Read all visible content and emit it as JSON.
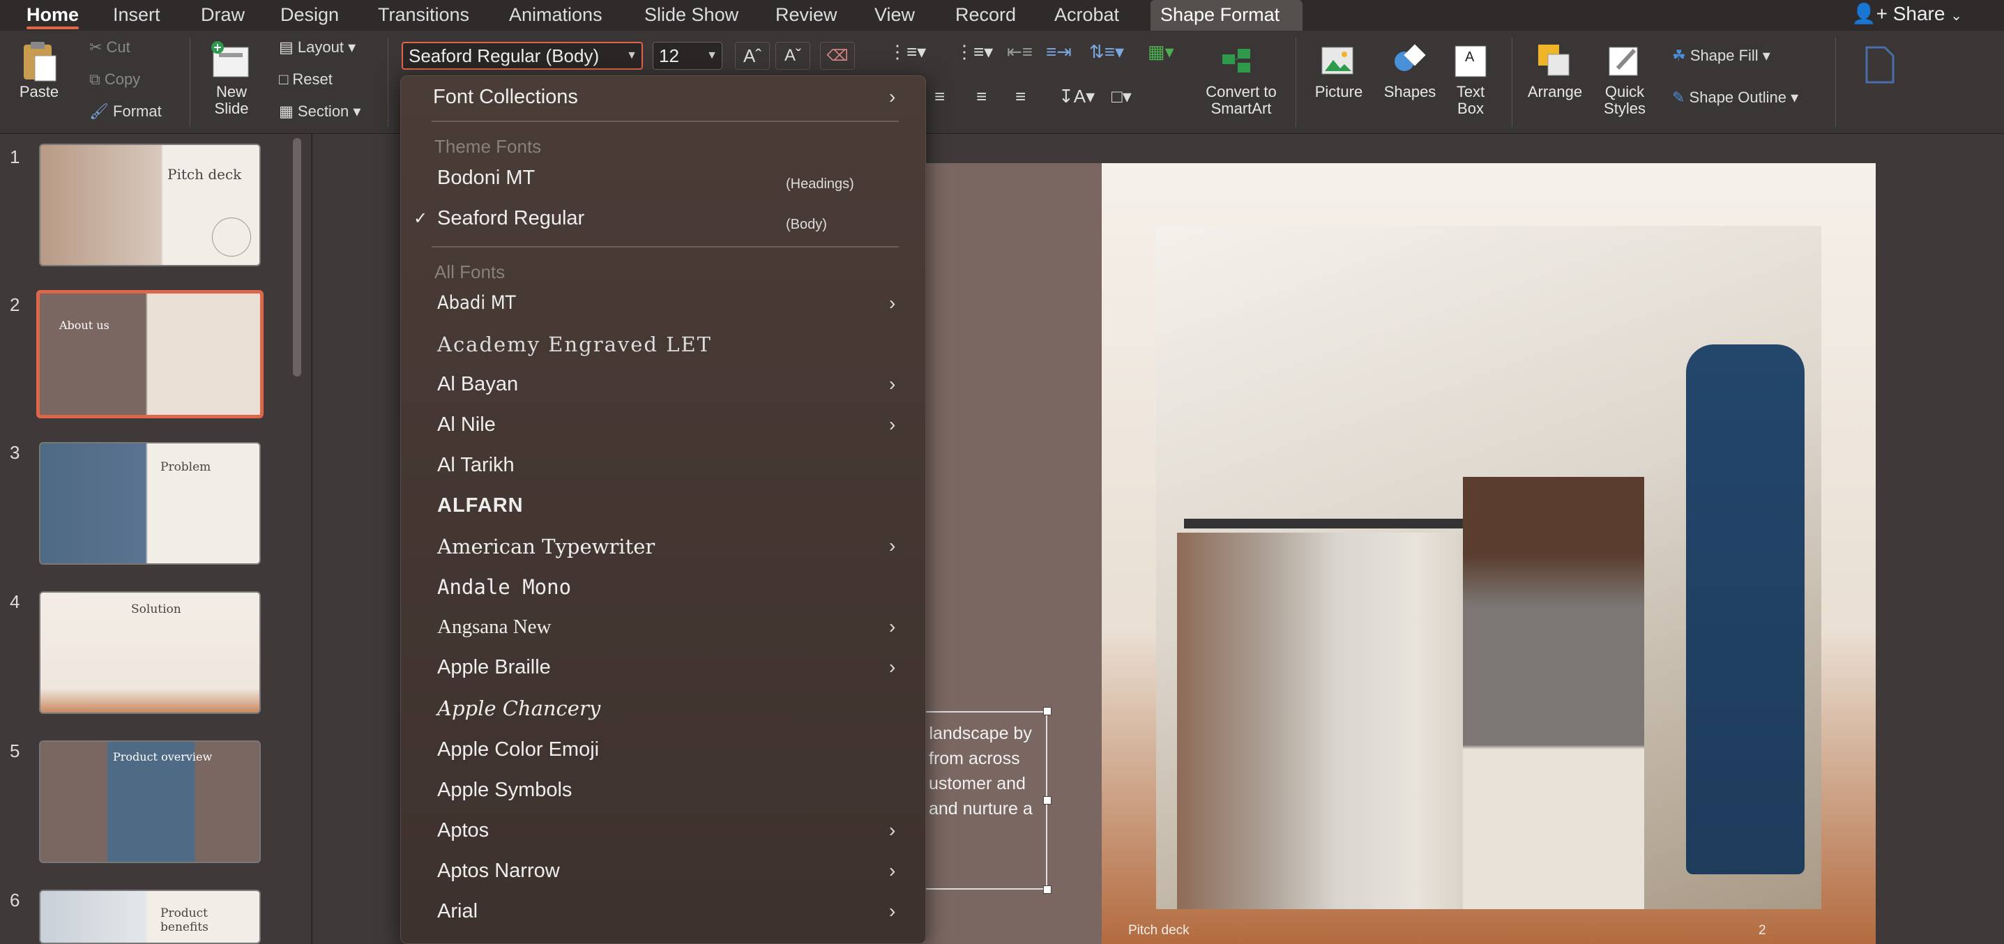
{
  "tabs": [
    "Home",
    "Insert",
    "Draw",
    "Design",
    "Transitions",
    "Animations",
    "Slide Show",
    "Review",
    "View",
    "Record",
    "Acrobat",
    "Shape Format"
  ],
  "share_label": "Share",
  "ribbon": {
    "paste": "Paste",
    "cut": "Cut",
    "copy": "Copy",
    "format": "Format",
    "new_slide": [
      "New",
      "Slide"
    ],
    "layout": "Layout",
    "reset": "Reset",
    "section": "Section",
    "font_name": "Seaford Regular (Body)",
    "font_size": "12",
    "convert_smartart": [
      "Convert to",
      "SmartArt"
    ],
    "picture": "Picture",
    "shapes": "Shapes",
    "text_box": [
      "Text",
      "Box"
    ],
    "arrange": "Arrange",
    "quick_styles": [
      "Quick",
      "Styles"
    ],
    "shape_fill": "Shape Fill",
    "shape_outline": "Shape Outline"
  },
  "slides": [
    {
      "num": "1",
      "title": "Pitch deck"
    },
    {
      "num": "2",
      "title": "About us"
    },
    {
      "num": "3",
      "title": "Problem"
    },
    {
      "num": "4",
      "title": "Solution"
    },
    {
      "num": "5",
      "title": "Product overview"
    },
    {
      "num": "6",
      "title": "Product benefits"
    }
  ],
  "slide": {
    "body_lines": [
      "l landscape by",
      "from across",
      "ustomer and",
      "and nurture a"
    ],
    "footer_left": "Pitch deck",
    "footer_right": "2"
  },
  "font_menu": {
    "font_collections": "Font Collections",
    "theme_header": "Theme Fonts",
    "theme": [
      {
        "name": "Bodoni MT",
        "note": "(Headings)"
      },
      {
        "name": "Seaford Regular",
        "note": "(Body)",
        "checked": "✓"
      }
    ],
    "all_header": "All Fonts",
    "fonts": [
      "Abadi MT",
      "Academy Engraved LET",
      "Al Bayan",
      "Al Nile",
      "Al Tarikh",
      "ALFARN",
      "American Typewriter",
      "Andale Mono",
      "Angsana New",
      "Apple Braille",
      "Apple Chancery",
      "Apple Color Emoji",
      "Apple  Symbols",
      "Aptos",
      "Aptos Narrow",
      "Arial"
    ]
  }
}
